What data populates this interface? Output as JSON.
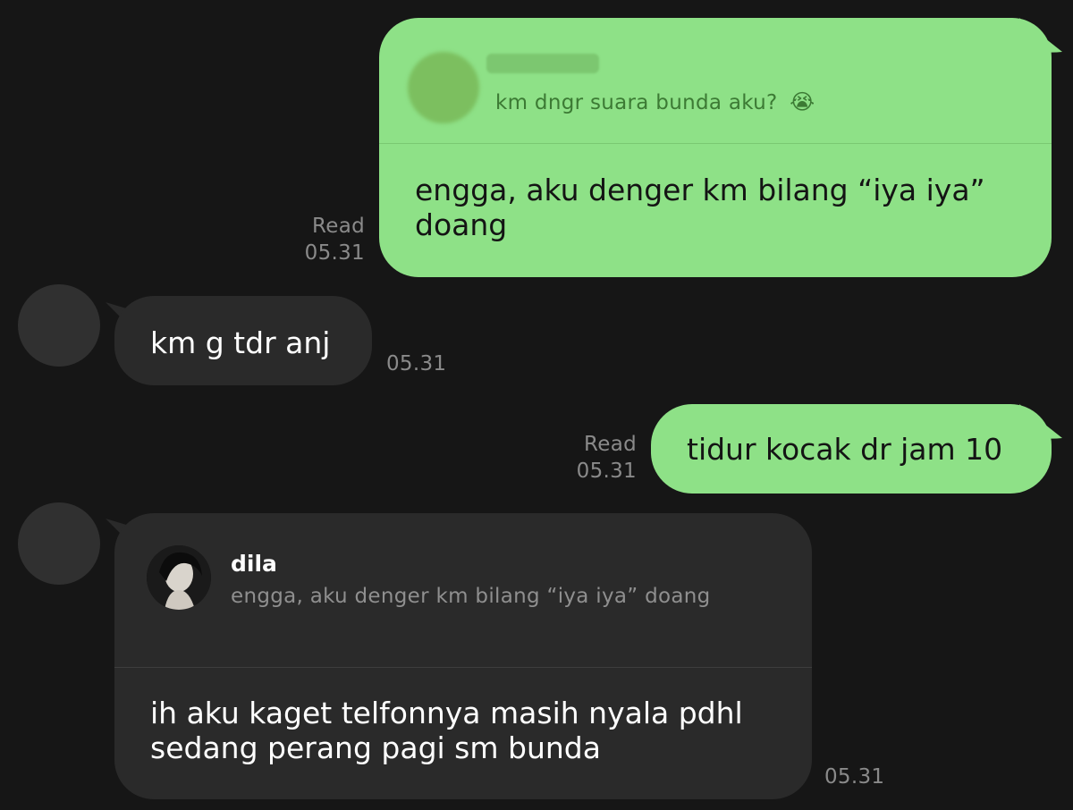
{
  "colors": {
    "background": "#161616",
    "outgoing_bubble": "#8ee187",
    "incoming_bubble": "#2a2a2a",
    "meta_text": "#8a8a8a"
  },
  "messages": [
    {
      "direction": "outgoing",
      "reply": {
        "quoted_text": "km dngr suara bunda aku?",
        "quoted_emoji": "😭"
      },
      "text": "engga, aku denger km bilang “iya iya”\ndoang",
      "status": "Read",
      "time": "05.31"
    },
    {
      "direction": "incoming",
      "text": "km g tdr anj",
      "time": "05.31"
    },
    {
      "direction": "outgoing",
      "text": "tidur kocak dr jam 10",
      "status": "Read",
      "time": "05.31"
    },
    {
      "direction": "incoming",
      "reply": {
        "quoted_name": "dila",
        "quoted_text": "engga, aku denger km bilang “iya iya” doang"
      },
      "text": "ih aku kaget telfonnya masih nyala pdhl\nsedang perang pagi sm bunda",
      "time": "05.31"
    }
  ]
}
